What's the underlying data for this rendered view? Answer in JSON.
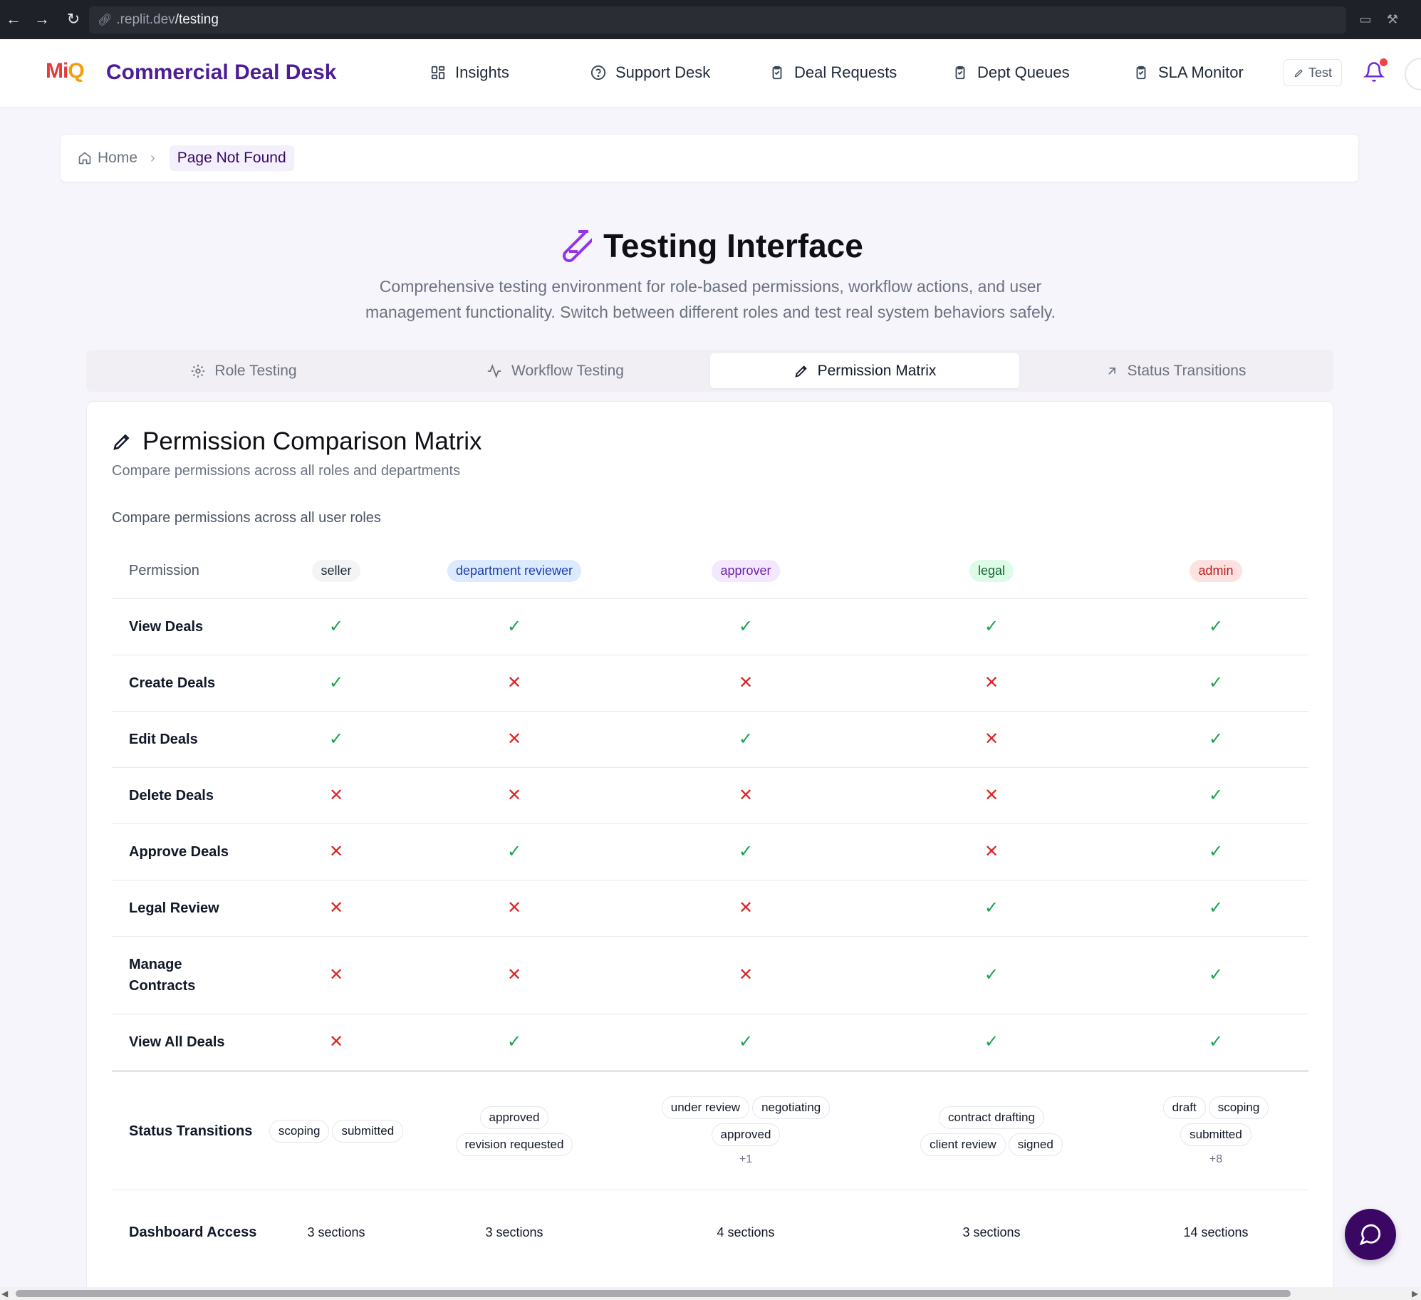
{
  "browser": {
    "url_host": ".replit.dev",
    "url_path": "/testing"
  },
  "header": {
    "logo_part1": "Mi",
    "logo_part2": "Q",
    "app_title": "Commercial Deal Desk",
    "nav": [
      {
        "label": "Insights",
        "icon": "grid-icon"
      },
      {
        "label": "Support Desk",
        "icon": "help-circle-icon"
      },
      {
        "label": "Deal Requests",
        "icon": "clipboard-icon"
      },
      {
        "label": "Dept Queues",
        "icon": "clipboard-icon"
      },
      {
        "label": "SLA Monitor",
        "icon": "clipboard-icon"
      }
    ],
    "test_button": "Test"
  },
  "breadcrumb": {
    "home": "Home",
    "current": "Page Not Found"
  },
  "hero": {
    "title": "Testing Interface",
    "description": "Comprehensive testing environment for role-based permissions, workflow actions, and user management functionality. Switch between different roles and test real system behaviors safely."
  },
  "tabs": [
    {
      "label": "Role Testing",
      "icon": "gear-icon",
      "active": false
    },
    {
      "label": "Workflow Testing",
      "icon": "activity-icon",
      "active": false
    },
    {
      "label": "Permission Matrix",
      "icon": "pencil-icon",
      "active": true
    },
    {
      "label": "Status Transitions",
      "icon": "arrow-up-right-icon",
      "active": false
    }
  ],
  "card": {
    "title": "Permission Comparison Matrix",
    "subtitle": "Compare permissions across all roles and departments",
    "subtitle2": "Compare permissions across all user roles"
  },
  "matrix": {
    "header_label": "Permission",
    "roles": [
      {
        "name": "seller",
        "bg": "#f3f4f6",
        "fg": "#1f2937"
      },
      {
        "name": "department reviewer",
        "bg": "#dbeafe",
        "fg": "#1e40af"
      },
      {
        "name": "approver",
        "bg": "#f3e8ff",
        "fg": "#6b21a8"
      },
      {
        "name": "legal",
        "bg": "#dcfce7",
        "fg": "#166534"
      },
      {
        "name": "admin",
        "bg": "#fee2e2",
        "fg": "#b91c1c"
      }
    ],
    "permissions": [
      {
        "label": "View Deals",
        "values": [
          true,
          true,
          true,
          true,
          true
        ]
      },
      {
        "label": "Create Deals",
        "values": [
          true,
          false,
          false,
          false,
          true
        ]
      },
      {
        "label": "Edit Deals",
        "values": [
          true,
          false,
          true,
          false,
          true
        ]
      },
      {
        "label": "Delete Deals",
        "values": [
          false,
          false,
          false,
          false,
          true
        ]
      },
      {
        "label": "Approve Deals",
        "values": [
          false,
          true,
          true,
          false,
          true
        ]
      },
      {
        "label": "Legal Review",
        "values": [
          false,
          false,
          false,
          true,
          true
        ]
      },
      {
        "label": "Manage Contracts",
        "values": [
          false,
          false,
          false,
          true,
          true
        ]
      },
      {
        "label": "View All Deals",
        "values": [
          false,
          true,
          true,
          true,
          true
        ]
      }
    ],
    "status_transitions": {
      "label": "Status Transitions",
      "values": [
        {
          "chips": [
            "scoping",
            "submitted"
          ],
          "more": ""
        },
        {
          "chips": [
            "approved",
            "revision requested"
          ],
          "more": ""
        },
        {
          "chips": [
            "under review",
            "negotiating",
            "approved"
          ],
          "more": "+1"
        },
        {
          "chips": [
            "contract drafting",
            "client review",
            "signed"
          ],
          "more": ""
        },
        {
          "chips": [
            "draft",
            "scoping",
            "submitted"
          ],
          "more": "+8"
        }
      ]
    },
    "dashboard_access": {
      "label": "Dashboard Access",
      "values": [
        "3 sections",
        "3 sections",
        "4 sections",
        "3 sections",
        "14 sections"
      ]
    }
  },
  "colors": {
    "brand": "#4c1d95",
    "check": "#16a34a",
    "cross": "#dc2626"
  }
}
